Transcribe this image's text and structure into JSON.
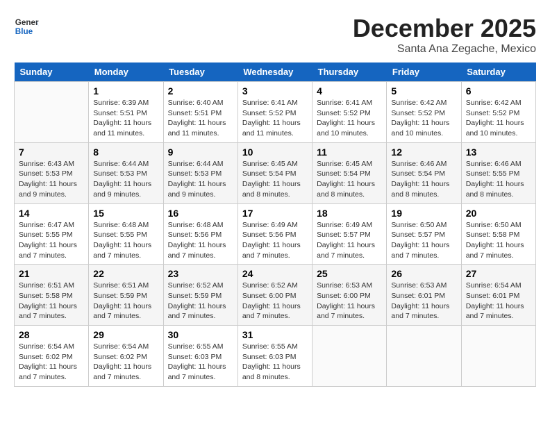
{
  "header": {
    "logo": {
      "general": "General",
      "blue": "Blue",
      "tagline": "General\nBlue"
    },
    "month": "December 2025",
    "location": "Santa Ana Zegache, Mexico"
  },
  "weekdays": [
    "Sunday",
    "Monday",
    "Tuesday",
    "Wednesday",
    "Thursday",
    "Friday",
    "Saturday"
  ],
  "weeks": [
    [
      {
        "date": "",
        "sunrise": "",
        "sunset": "",
        "daylight": ""
      },
      {
        "date": "1",
        "sunrise": "Sunrise: 6:39 AM",
        "sunset": "Sunset: 5:51 PM",
        "daylight": "Daylight: 11 hours and 11 minutes."
      },
      {
        "date": "2",
        "sunrise": "Sunrise: 6:40 AM",
        "sunset": "Sunset: 5:51 PM",
        "daylight": "Daylight: 11 hours and 11 minutes."
      },
      {
        "date": "3",
        "sunrise": "Sunrise: 6:41 AM",
        "sunset": "Sunset: 5:52 PM",
        "daylight": "Daylight: 11 hours and 11 minutes."
      },
      {
        "date": "4",
        "sunrise": "Sunrise: 6:41 AM",
        "sunset": "Sunset: 5:52 PM",
        "daylight": "Daylight: 11 hours and 10 minutes."
      },
      {
        "date": "5",
        "sunrise": "Sunrise: 6:42 AM",
        "sunset": "Sunset: 5:52 PM",
        "daylight": "Daylight: 11 hours and 10 minutes."
      },
      {
        "date": "6",
        "sunrise": "Sunrise: 6:42 AM",
        "sunset": "Sunset: 5:52 PM",
        "daylight": "Daylight: 11 hours and 10 minutes."
      }
    ],
    [
      {
        "date": "7",
        "sunrise": "Sunrise: 6:43 AM",
        "sunset": "Sunset: 5:53 PM",
        "daylight": "Daylight: 11 hours and 9 minutes."
      },
      {
        "date": "8",
        "sunrise": "Sunrise: 6:44 AM",
        "sunset": "Sunset: 5:53 PM",
        "daylight": "Daylight: 11 hours and 9 minutes."
      },
      {
        "date": "9",
        "sunrise": "Sunrise: 6:44 AM",
        "sunset": "Sunset: 5:53 PM",
        "daylight": "Daylight: 11 hours and 9 minutes."
      },
      {
        "date": "10",
        "sunrise": "Sunrise: 6:45 AM",
        "sunset": "Sunset: 5:54 PM",
        "daylight": "Daylight: 11 hours and 8 minutes."
      },
      {
        "date": "11",
        "sunrise": "Sunrise: 6:45 AM",
        "sunset": "Sunset: 5:54 PM",
        "daylight": "Daylight: 11 hours and 8 minutes."
      },
      {
        "date": "12",
        "sunrise": "Sunrise: 6:46 AM",
        "sunset": "Sunset: 5:54 PM",
        "daylight": "Daylight: 11 hours and 8 minutes."
      },
      {
        "date": "13",
        "sunrise": "Sunrise: 6:46 AM",
        "sunset": "Sunset: 5:55 PM",
        "daylight": "Daylight: 11 hours and 8 minutes."
      }
    ],
    [
      {
        "date": "14",
        "sunrise": "Sunrise: 6:47 AM",
        "sunset": "Sunset: 5:55 PM",
        "daylight": "Daylight: 11 hours and 7 minutes."
      },
      {
        "date": "15",
        "sunrise": "Sunrise: 6:48 AM",
        "sunset": "Sunset: 5:55 PM",
        "daylight": "Daylight: 11 hours and 7 minutes."
      },
      {
        "date": "16",
        "sunrise": "Sunrise: 6:48 AM",
        "sunset": "Sunset: 5:56 PM",
        "daylight": "Daylight: 11 hours and 7 minutes."
      },
      {
        "date": "17",
        "sunrise": "Sunrise: 6:49 AM",
        "sunset": "Sunset: 5:56 PM",
        "daylight": "Daylight: 11 hours and 7 minutes."
      },
      {
        "date": "18",
        "sunrise": "Sunrise: 6:49 AM",
        "sunset": "Sunset: 5:57 PM",
        "daylight": "Daylight: 11 hours and 7 minutes."
      },
      {
        "date": "19",
        "sunrise": "Sunrise: 6:50 AM",
        "sunset": "Sunset: 5:57 PM",
        "daylight": "Daylight: 11 hours and 7 minutes."
      },
      {
        "date": "20",
        "sunrise": "Sunrise: 6:50 AM",
        "sunset": "Sunset: 5:58 PM",
        "daylight": "Daylight: 11 hours and 7 minutes."
      }
    ],
    [
      {
        "date": "21",
        "sunrise": "Sunrise: 6:51 AM",
        "sunset": "Sunset: 5:58 PM",
        "daylight": "Daylight: 11 hours and 7 minutes."
      },
      {
        "date": "22",
        "sunrise": "Sunrise: 6:51 AM",
        "sunset": "Sunset: 5:59 PM",
        "daylight": "Daylight: 11 hours and 7 minutes."
      },
      {
        "date": "23",
        "sunrise": "Sunrise: 6:52 AM",
        "sunset": "Sunset: 5:59 PM",
        "daylight": "Daylight: 11 hours and 7 minutes."
      },
      {
        "date": "24",
        "sunrise": "Sunrise: 6:52 AM",
        "sunset": "Sunset: 6:00 PM",
        "daylight": "Daylight: 11 hours and 7 minutes."
      },
      {
        "date": "25",
        "sunrise": "Sunrise: 6:53 AM",
        "sunset": "Sunset: 6:00 PM",
        "daylight": "Daylight: 11 hours and 7 minutes."
      },
      {
        "date": "26",
        "sunrise": "Sunrise: 6:53 AM",
        "sunset": "Sunset: 6:01 PM",
        "daylight": "Daylight: 11 hours and 7 minutes."
      },
      {
        "date": "27",
        "sunrise": "Sunrise: 6:54 AM",
        "sunset": "Sunset: 6:01 PM",
        "daylight": "Daylight: 11 hours and 7 minutes."
      }
    ],
    [
      {
        "date": "28",
        "sunrise": "Sunrise: 6:54 AM",
        "sunset": "Sunset: 6:02 PM",
        "daylight": "Daylight: 11 hours and 7 minutes."
      },
      {
        "date": "29",
        "sunrise": "Sunrise: 6:54 AM",
        "sunset": "Sunset: 6:02 PM",
        "daylight": "Daylight: 11 hours and 7 minutes."
      },
      {
        "date": "30",
        "sunrise": "Sunrise: 6:55 AM",
        "sunset": "Sunset: 6:03 PM",
        "daylight": "Daylight: 11 hours and 7 minutes."
      },
      {
        "date": "31",
        "sunrise": "Sunrise: 6:55 AM",
        "sunset": "Sunset: 6:03 PM",
        "daylight": "Daylight: 11 hours and 8 minutes."
      },
      {
        "date": "",
        "sunrise": "",
        "sunset": "",
        "daylight": ""
      },
      {
        "date": "",
        "sunrise": "",
        "sunset": "",
        "daylight": ""
      },
      {
        "date": "",
        "sunrise": "",
        "sunset": "",
        "daylight": ""
      }
    ]
  ]
}
